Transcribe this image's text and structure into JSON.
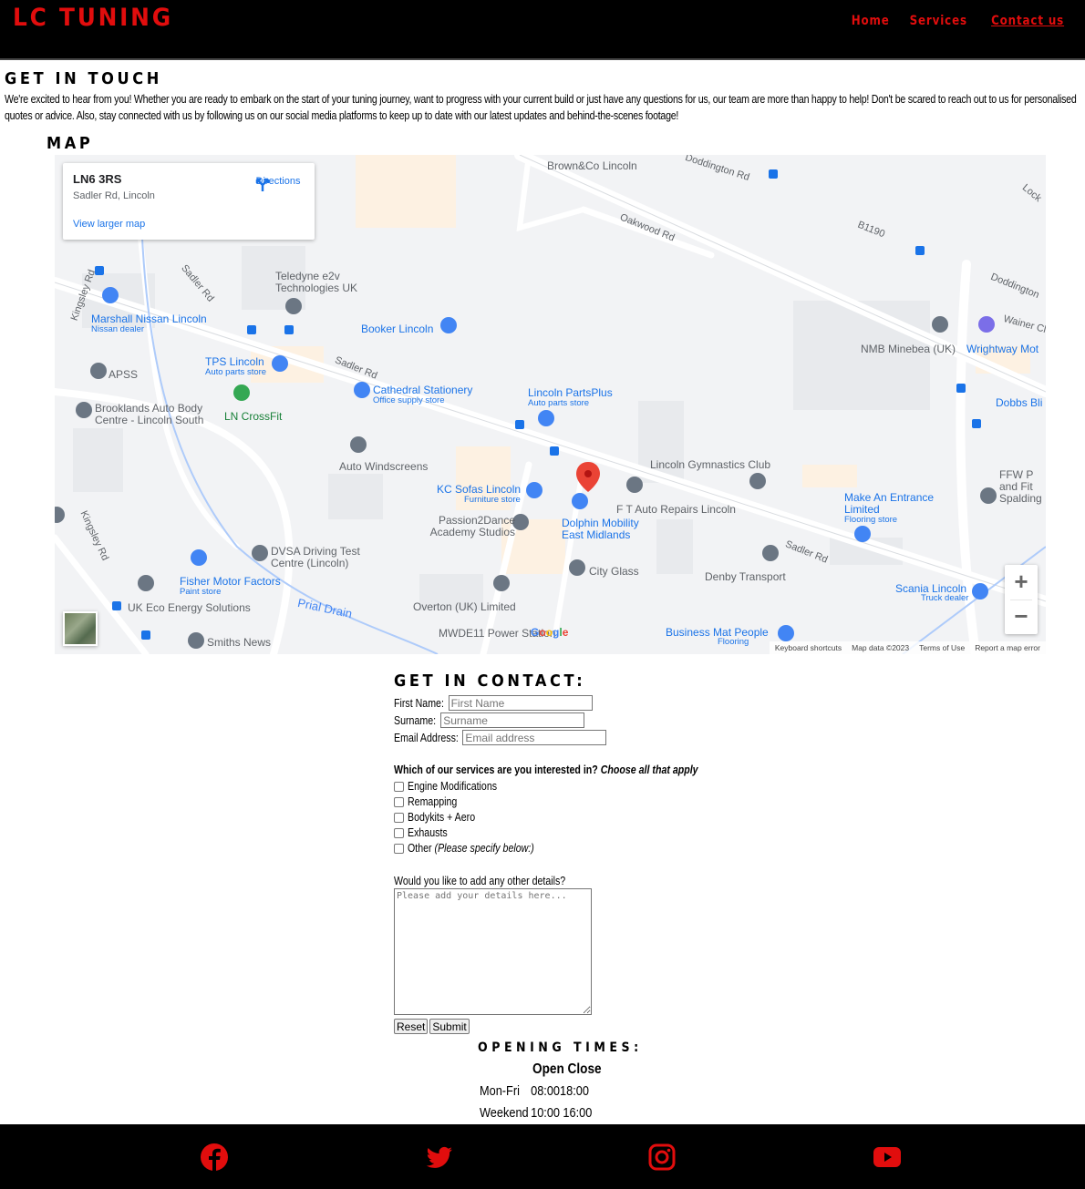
{
  "header": {
    "brand": "LC TUNING",
    "nav": [
      "Home",
      "Services",
      "Contact us"
    ],
    "active_nav": "Contact us",
    "accent_color": "#e10d0d"
  },
  "intro": {
    "title": "GET IN TOUCH",
    "text": "We're excited to hear from you! Whether you are ready to embark on the start of your tuning journey, want to progress with your current build or just have any questions for us, our team are more than happy to help! Don't be scared to reach out to us for personalised quotes or advice. Also, stay connected with us by following us on our social media platforms to keep up to date with our latest updates and behind-the-scenes footage!"
  },
  "map": {
    "title": "MAP",
    "card": {
      "address": "LN6 3RS",
      "subtitle": "Sadler Rd, Lincoln",
      "directions": "Directions",
      "larger": "View larger map"
    },
    "places": [
      "Brown&Co Lincoln",
      "Teledyne e2v Technologies UK",
      "Booker Lincoln",
      "Marshall Nissan Lincoln",
      "Nissan dealer",
      "APSS",
      "TPS Lincoln",
      "Auto parts store",
      "Cathedral Stationery",
      "Office supply store",
      "Lincoln PartsPlus",
      "Brooklands Auto Body Centre - Lincoln South",
      "LN CrossFit",
      "Auto Windscreens",
      "KC Sofas Lincoln",
      "Furniture store",
      "Lincoln Gymnastics Club",
      "F T Auto Repairs Lincoln",
      "Passion2Dance Academy Studios",
      "Dolphin Mobility East Midlands",
      "DVSA Driving Test Centre (Lincoln)",
      "Fisher Motor Factors",
      "Paint store",
      "City Glass",
      "Denby Transport",
      "UK Eco Energy Solutions",
      "Overton (UK) Limited",
      "MWDE11 Power Station",
      "Smiths News",
      "NMB Minebea (UK)",
      "Wrightway Mot",
      "Dobbs Bli",
      "Make An Entrance Limited",
      "Flooring store",
      "FFW P and Fit Spalding",
      "Scania Lincoln",
      "Truck dealer",
      "Business Mat People",
      "Flooring"
    ],
    "roads": [
      "Doddington Rd",
      "Oakwood Rd",
      "B1190",
      "Doddington",
      "Sadler Rd",
      "Kingsley Rd",
      "Prial Drain",
      "Wainer Cl",
      "Lock"
    ],
    "attribution": [
      "Keyboard shortcuts",
      "Map data ©2023",
      "Terms of Use",
      "Report a map error"
    ],
    "google": "Google"
  },
  "contact": {
    "title": "GET IN CONTACT:",
    "first_name_label": "First Name:",
    "first_name_placeholder": "First Name",
    "surname_label": "Surname:",
    "surname_placeholder": "Surname",
    "email_label": "Email Address:",
    "email_placeholder": "Email address",
    "services_question": "Which of our services are you interested in?",
    "services_hint": "Choose all that apply",
    "services": [
      "Engine Modifications",
      "Remapping",
      "Bodykits + Aero",
      "Exhausts",
      "Other"
    ],
    "other_hint": "(Please specify below:)",
    "details_label": "Would you like to add any other details?",
    "details_placeholder": "Please add your details here...",
    "reset": "Reset",
    "submit": "Submit"
  },
  "opening": {
    "title": "OPENING TIMES:",
    "header": "Open Close",
    "rows": [
      {
        "day": "Mon-Fri",
        "open": "08:00",
        "close": "18:00"
      },
      {
        "day": "Weekend",
        "open": "10:00",
        "close": "16:00"
      }
    ]
  },
  "footer": {
    "socials": [
      "facebook-icon",
      "twitter-icon",
      "instagram-icon",
      "youtube-icon"
    ]
  }
}
